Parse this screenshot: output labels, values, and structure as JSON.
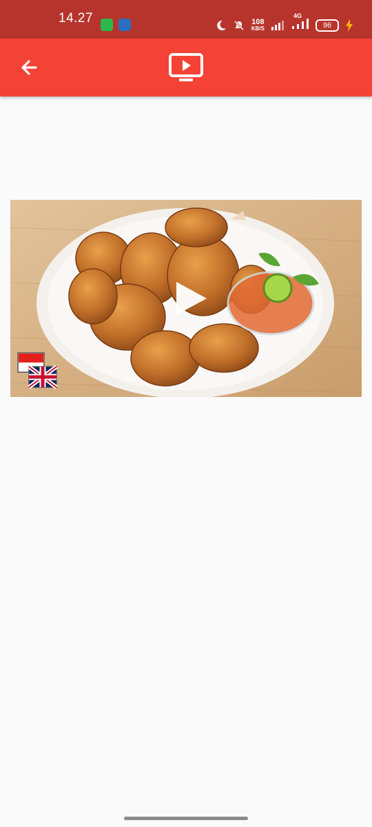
{
  "status_bar": {
    "time": "14.27",
    "speed_value": "108",
    "speed_unit": "KB/S",
    "network_type": "4G",
    "battery": "96",
    "color": "#b7342d",
    "icons": [
      "app-store-notification-icon",
      "app-notification-icon",
      "moon-icon",
      "muted-bell-icon",
      "signal-icon",
      "signal-4g-icon",
      "battery-icon",
      "charging-icon"
    ]
  },
  "app_bar": {
    "color": "#f44336",
    "back_icon": "arrow-left-icon",
    "title_icon": "tv-play-icon"
  },
  "video": {
    "thumbnail": "fried chicken on white plate with sambal",
    "play_icon": "play-icon",
    "language_icons": [
      "indonesia-flag-icon",
      "uk-flag-icon"
    ]
  }
}
